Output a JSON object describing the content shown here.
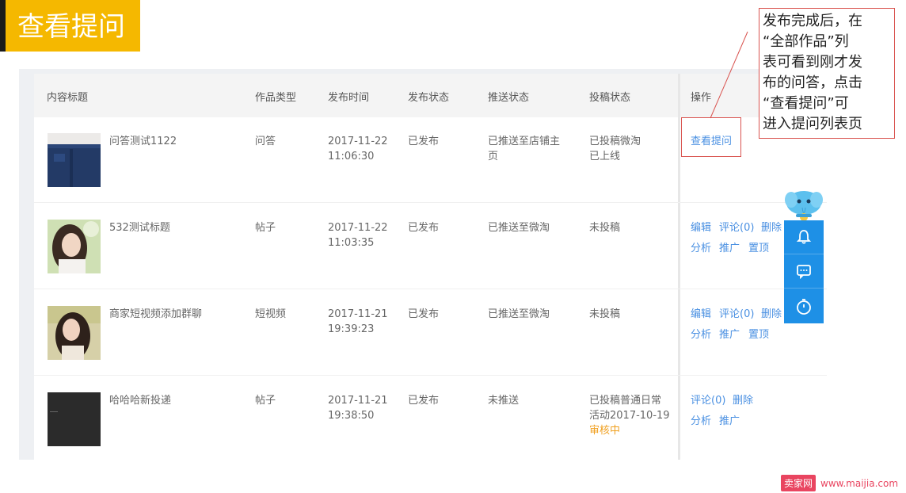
{
  "page_title": "查看提问",
  "callout": {
    "lines": [
      "发布完成后，在",
      "“全部作品”列",
      "表可看到刚才发",
      "布的问答，点击",
      "“查看提问”可",
      "进入提问列表页"
    ]
  },
  "table": {
    "headers": {
      "title": "内容标题",
      "type": "作品类型",
      "time": "发布时间",
      "publish_status": "发布状态",
      "push_status": "推送状态",
      "submit_status": "投稿状态",
      "actions": "操作"
    },
    "rows": [
      {
        "title": "问答测试1122",
        "type": "问答",
        "date": "2017-11-22",
        "clock": "11:06:30",
        "publish_status": "已发布",
        "push_line1": "已推送至店铺主",
        "push_line2": "页",
        "submit_line1": "已投稿微淘",
        "submit_line2": "已上线",
        "actions": [
          "查看提问"
        ]
      },
      {
        "title": "532测试标题",
        "type": "帖子",
        "date": "2017-11-22",
        "clock": "11:03:35",
        "publish_status": "已发布",
        "push_line1": "已推送至微淘",
        "submit_line1": "未投稿",
        "actions": [
          "编辑",
          "评论(0)",
          "删除",
          "分析",
          "推广",
          "置顶"
        ]
      },
      {
        "title": "商家短视频添加群聊",
        "type": "短视频",
        "date": "2017-11-21",
        "clock": "19:39:23",
        "publish_status": "已发布",
        "push_line1": "已推送至微淘",
        "submit_line1": "未投稿",
        "actions": [
          "编辑",
          "评论(0)",
          "删除",
          "分析",
          "推广",
          "置顶"
        ]
      },
      {
        "title": "哈哈哈新投递",
        "type": "帖子",
        "date": "2017-11-21",
        "clock": "19:38:50",
        "publish_status": "已发布",
        "push_line1": "未推送",
        "submit_line1": "已投稿普通日常",
        "submit_line2": "活动2017-10-19",
        "submit_line3": "审核中",
        "actions": [
          "评论(0)",
          "删除",
          "分析",
          "推广"
        ]
      }
    ]
  },
  "float_toolbar": {
    "icons": [
      "mascot-icon",
      "bell-icon",
      "message-icon",
      "timer-icon"
    ]
  },
  "watermark": {
    "badge": "卖家网",
    "url": "www.maijia.com"
  },
  "colors": {
    "banner": "#f5b800",
    "link": "#4a90e2",
    "highlight_box": "#d9534f",
    "toolbar": "#1e90e6",
    "review_status": "#f0a020"
  }
}
